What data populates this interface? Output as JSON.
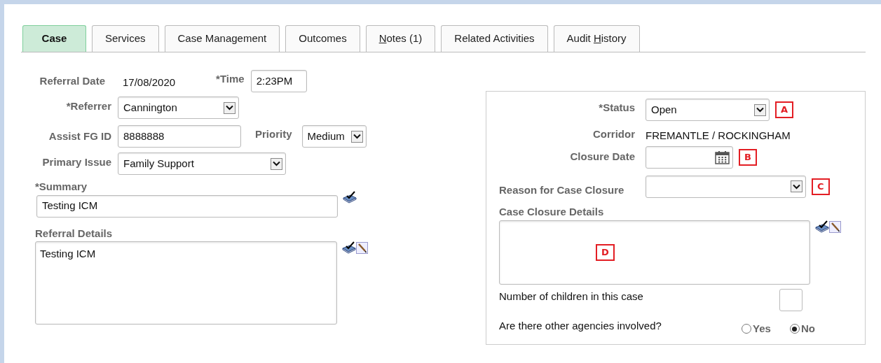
{
  "tabs": [
    {
      "label": "Case",
      "selected": true
    },
    {
      "label": "Services",
      "selected": false
    },
    {
      "label": "Case Management",
      "selected": false
    },
    {
      "label": "Outcomes",
      "selected": false
    },
    {
      "key": "N",
      "after": "otes (1)",
      "selected": false
    },
    {
      "label": "Related Activities",
      "selected": false
    },
    {
      "label": "Audit ",
      "key": "H",
      "after": "istory",
      "selected": false
    }
  ],
  "left": {
    "referral_date": {
      "label": "Referral Date",
      "value": "17/08/2020"
    },
    "time": {
      "label": "*Time",
      "value": "2:23PM"
    },
    "referrer": {
      "label": "*Referrer",
      "value": "Cannington"
    },
    "assist_fg_id": {
      "label": "Assist FG ID",
      "value": "8888888"
    },
    "priority": {
      "label": "Priority",
      "value": "Medium"
    },
    "primary_issue": {
      "label": "Primary Issue",
      "value": "Family Support"
    },
    "summary": {
      "label": "*Summary",
      "value": "Testing ICM"
    },
    "referral_details": {
      "label": "Referral Details",
      "value": "Testing ICM"
    }
  },
  "right": {
    "status": {
      "label": "*Status",
      "value": "Open",
      "callout": "A"
    },
    "corridor": {
      "label": "Corridor",
      "value": "FREMANTLE / ROCKINGHAM"
    },
    "closure_date": {
      "label": "Closure Date",
      "callout": "B"
    },
    "reason": {
      "label": "Reason for Case Closure",
      "callout": "C"
    },
    "closure_details": {
      "label": "Case Closure Details",
      "callout": "D"
    },
    "children": {
      "label": "Number of children in this case"
    },
    "agencies": {
      "label": "Are there other agencies involved?",
      "options": [
        {
          "label": "Yes",
          "selected": false
        },
        {
          "label": "No",
          "selected": true
        }
      ]
    }
  }
}
